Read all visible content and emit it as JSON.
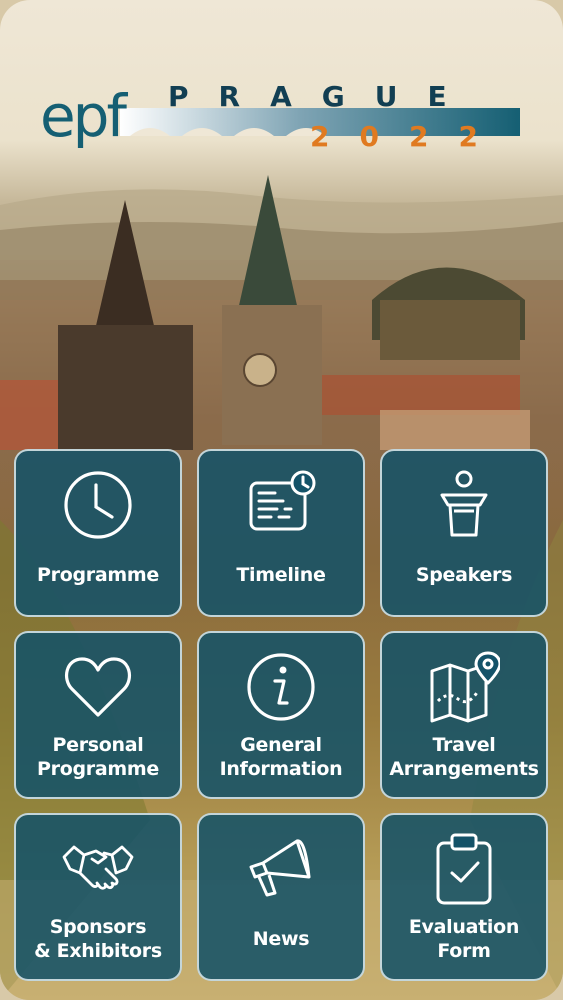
{
  "logo": {
    "brand": "epf",
    "city": "PRAGUE",
    "year": "2022"
  },
  "menu": {
    "programme": "Programme",
    "timeline": "Timeline",
    "speakers": "Speakers",
    "personal_line1": "Personal",
    "personal_line2": "Programme",
    "general_line1": "General",
    "general_line2": "Information",
    "travel_line1": "Travel",
    "travel_line2": "Arrangements",
    "sponsors_line1": "Sponsors",
    "sponsors_line2": "& Exhibitors",
    "news": "News",
    "evaluation_line1": "Evaluation",
    "evaluation_line2": "Form"
  },
  "colors": {
    "tile": "#145268",
    "brand_teal": "#155f73",
    "brand_orange": "#e07a20"
  },
  "icons": [
    "clock-icon",
    "timeline-icon",
    "speaker-podium-icon",
    "heart-icon",
    "info-icon",
    "map-pin-icon",
    "handshake-icon",
    "megaphone-icon",
    "clipboard-check-icon"
  ]
}
